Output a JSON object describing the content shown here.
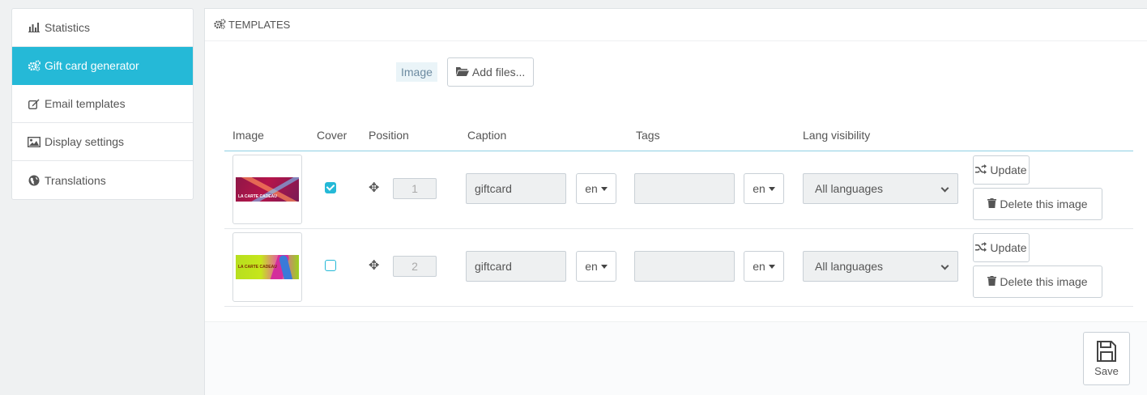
{
  "sidebar": {
    "items": [
      {
        "label": "Statistics",
        "icon": "bar-chart-icon",
        "active": false
      },
      {
        "label": "Gift card generator",
        "icon": "cogs-icon",
        "active": true
      },
      {
        "label": "Email templates",
        "icon": "edit-icon",
        "active": false
      },
      {
        "label": "Display settings",
        "icon": "picture-icon",
        "active": false
      },
      {
        "label": "Translations",
        "icon": "globe-icon",
        "active": false
      }
    ]
  },
  "panel": {
    "title": "TEMPLATES",
    "title_icon": "cogs-icon",
    "upload": {
      "label": "Image",
      "add_files": "Add files..."
    },
    "columns": {
      "image": "Image",
      "cover": "Cover",
      "position": "Position",
      "caption": "Caption",
      "tags": "Tags",
      "lang_visibility": "Lang visibility"
    },
    "rows": [
      {
        "card_text": "LA CARTE CADEAU",
        "cover": true,
        "position": "1",
        "caption": "giftcard",
        "caption_lang": "en",
        "tags": "",
        "tags_lang": "en",
        "visibility": "All languages",
        "update_label": "Update",
        "delete_label": "Delete this image"
      },
      {
        "card_text": "LA CARTE CADEAU",
        "cover": false,
        "position": "2",
        "caption": "giftcard",
        "caption_lang": "en",
        "tags": "",
        "tags_lang": "en",
        "visibility": "All languages",
        "update_label": "Update",
        "delete_label": "Delete this image"
      }
    ],
    "save_label": "Save"
  },
  "colors": {
    "accent": "#25b9d7",
    "background": "#eff1f2"
  }
}
